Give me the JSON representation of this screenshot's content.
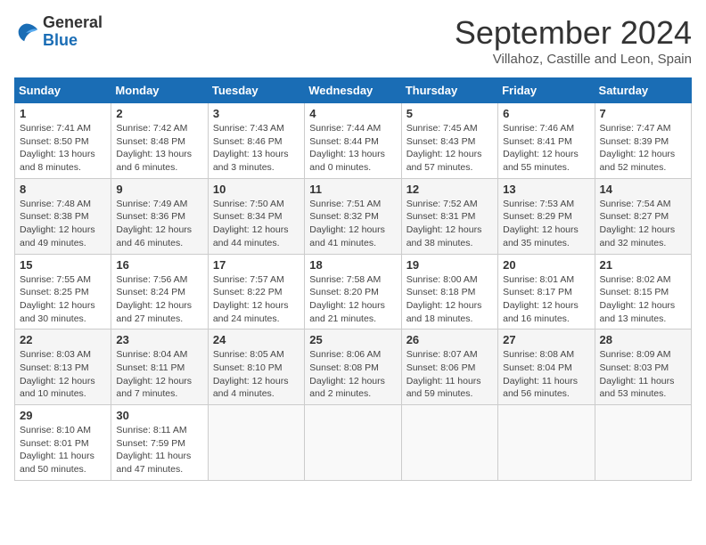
{
  "header": {
    "logo": {
      "line1": "General",
      "line2": "Blue"
    },
    "title": "September 2024",
    "location": "Villahoz, Castille and Leon, Spain"
  },
  "weekdays": [
    "Sunday",
    "Monday",
    "Tuesday",
    "Wednesday",
    "Thursday",
    "Friday",
    "Saturday"
  ],
  "weeks": [
    [
      {
        "day": "1",
        "sunrise": "7:41 AM",
        "sunset": "8:50 PM",
        "daylight": "13 hours and 8 minutes."
      },
      {
        "day": "2",
        "sunrise": "7:42 AM",
        "sunset": "8:48 PM",
        "daylight": "13 hours and 6 minutes."
      },
      {
        "day": "3",
        "sunrise": "7:43 AM",
        "sunset": "8:46 PM",
        "daylight": "13 hours and 3 minutes."
      },
      {
        "day": "4",
        "sunrise": "7:44 AM",
        "sunset": "8:44 PM",
        "daylight": "13 hours and 0 minutes."
      },
      {
        "day": "5",
        "sunrise": "7:45 AM",
        "sunset": "8:43 PM",
        "daylight": "12 hours and 57 minutes."
      },
      {
        "day": "6",
        "sunrise": "7:46 AM",
        "sunset": "8:41 PM",
        "daylight": "12 hours and 55 minutes."
      },
      {
        "day": "7",
        "sunrise": "7:47 AM",
        "sunset": "8:39 PM",
        "daylight": "12 hours and 52 minutes."
      }
    ],
    [
      {
        "day": "8",
        "sunrise": "7:48 AM",
        "sunset": "8:38 PM",
        "daylight": "12 hours and 49 minutes."
      },
      {
        "day": "9",
        "sunrise": "7:49 AM",
        "sunset": "8:36 PM",
        "daylight": "12 hours and 46 minutes."
      },
      {
        "day": "10",
        "sunrise": "7:50 AM",
        "sunset": "8:34 PM",
        "daylight": "12 hours and 44 minutes."
      },
      {
        "day": "11",
        "sunrise": "7:51 AM",
        "sunset": "8:32 PM",
        "daylight": "12 hours and 41 minutes."
      },
      {
        "day": "12",
        "sunrise": "7:52 AM",
        "sunset": "8:31 PM",
        "daylight": "12 hours and 38 minutes."
      },
      {
        "day": "13",
        "sunrise": "7:53 AM",
        "sunset": "8:29 PM",
        "daylight": "12 hours and 35 minutes."
      },
      {
        "day": "14",
        "sunrise": "7:54 AM",
        "sunset": "8:27 PM",
        "daylight": "12 hours and 32 minutes."
      }
    ],
    [
      {
        "day": "15",
        "sunrise": "7:55 AM",
        "sunset": "8:25 PM",
        "daylight": "12 hours and 30 minutes."
      },
      {
        "day": "16",
        "sunrise": "7:56 AM",
        "sunset": "8:24 PM",
        "daylight": "12 hours and 27 minutes."
      },
      {
        "day": "17",
        "sunrise": "7:57 AM",
        "sunset": "8:22 PM",
        "daylight": "12 hours and 24 minutes."
      },
      {
        "day": "18",
        "sunrise": "7:58 AM",
        "sunset": "8:20 PM",
        "daylight": "12 hours and 21 minutes."
      },
      {
        "day": "19",
        "sunrise": "8:00 AM",
        "sunset": "8:18 PM",
        "daylight": "12 hours and 18 minutes."
      },
      {
        "day": "20",
        "sunrise": "8:01 AM",
        "sunset": "8:17 PM",
        "daylight": "12 hours and 16 minutes."
      },
      {
        "day": "21",
        "sunrise": "8:02 AM",
        "sunset": "8:15 PM",
        "daylight": "12 hours and 13 minutes."
      }
    ],
    [
      {
        "day": "22",
        "sunrise": "8:03 AM",
        "sunset": "8:13 PM",
        "daylight": "12 hours and 10 minutes."
      },
      {
        "day": "23",
        "sunrise": "8:04 AM",
        "sunset": "8:11 PM",
        "daylight": "12 hours and 7 minutes."
      },
      {
        "day": "24",
        "sunrise": "8:05 AM",
        "sunset": "8:10 PM",
        "daylight": "12 hours and 4 minutes."
      },
      {
        "day": "25",
        "sunrise": "8:06 AM",
        "sunset": "8:08 PM",
        "daylight": "12 hours and 2 minutes."
      },
      {
        "day": "26",
        "sunrise": "8:07 AM",
        "sunset": "8:06 PM",
        "daylight": "11 hours and 59 minutes."
      },
      {
        "day": "27",
        "sunrise": "8:08 AM",
        "sunset": "8:04 PM",
        "daylight": "11 hours and 56 minutes."
      },
      {
        "day": "28",
        "sunrise": "8:09 AM",
        "sunset": "8:03 PM",
        "daylight": "11 hours and 53 minutes."
      }
    ],
    [
      {
        "day": "29",
        "sunrise": "8:10 AM",
        "sunset": "8:01 PM",
        "daylight": "11 hours and 50 minutes."
      },
      {
        "day": "30",
        "sunrise": "8:11 AM",
        "sunset": "7:59 PM",
        "daylight": "11 hours and 47 minutes."
      },
      null,
      null,
      null,
      null,
      null
    ]
  ]
}
